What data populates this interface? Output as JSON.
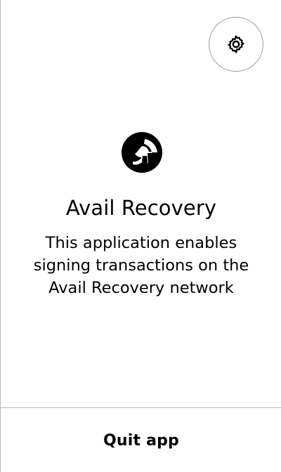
{
  "app": {
    "title": "Avail Recovery",
    "description": "This application enables signing transactions on the Avail Recovery network",
    "logo_icon": "avail-logo-icon"
  },
  "header": {
    "settings_icon": "gear-icon"
  },
  "footer": {
    "quit_label": "Quit app"
  },
  "colors": {
    "background": "#ffffff",
    "text": "#000000",
    "border": "#b8b8b8",
    "settings_border": "#9a9a9a"
  }
}
